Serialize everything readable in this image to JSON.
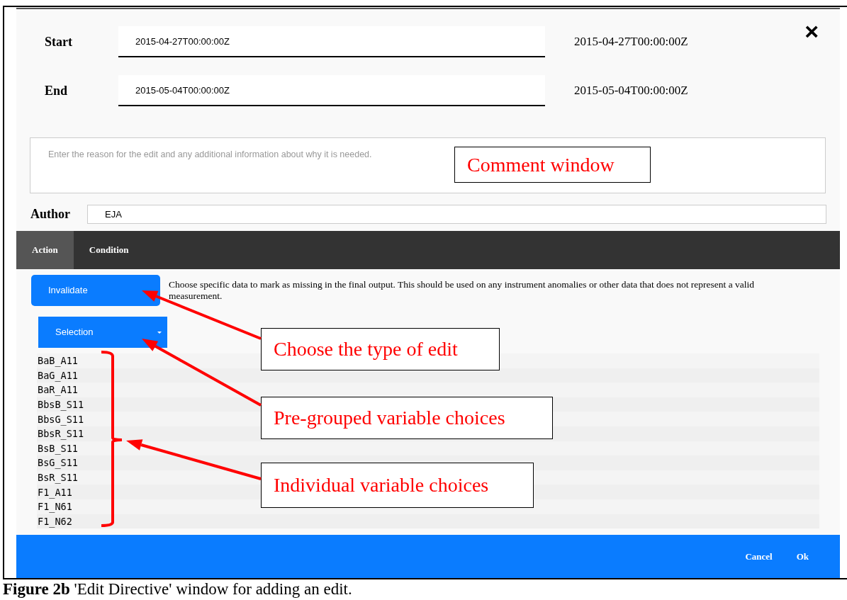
{
  "dialog": {
    "close": "×",
    "fields": [
      {
        "label": "Start",
        "value": "2015-04-27T00:00:00Z",
        "display": "2015-04-27T00:00:00Z"
      },
      {
        "label": "End",
        "value": "2015-05-04T00:00:00Z",
        "display": "2015-05-04T00:00:00Z"
      }
    ],
    "comment": {
      "placeholder": "Enter the reason for the edit and any additional information about why it is needed."
    },
    "author": {
      "label": "Author",
      "value": "EJA"
    },
    "tabs": [
      {
        "label": "Action",
        "selected": true
      },
      {
        "label": "Condition",
        "selected": false
      }
    ],
    "action_button": "Invalidate",
    "description": "Choose specific data to mark as missing in the final output. This should be used on any instrument anomalies or other data that does not represent a valid measurement.",
    "selection_dropdown": "Selection",
    "variables": [
      "BaB_A11",
      "BaG_A11",
      "BaR_A11",
      "BbsB_S11",
      "BbsG_S11",
      "BbsR_S11",
      "BsB_S11",
      "BsG_S11",
      "BsR_S11",
      "F1_A11",
      "F1_N61",
      "F1_N62"
    ],
    "footer_buttons": [
      "Cancel",
      "Ok"
    ]
  },
  "annotations": [
    "Comment window",
    "Choose the type of edit",
    "Pre-grouped variable choices",
    "Individual variable choices"
  ],
  "caption": "**Figure 2b** 'Edit Directive' window for adding an edit."
}
